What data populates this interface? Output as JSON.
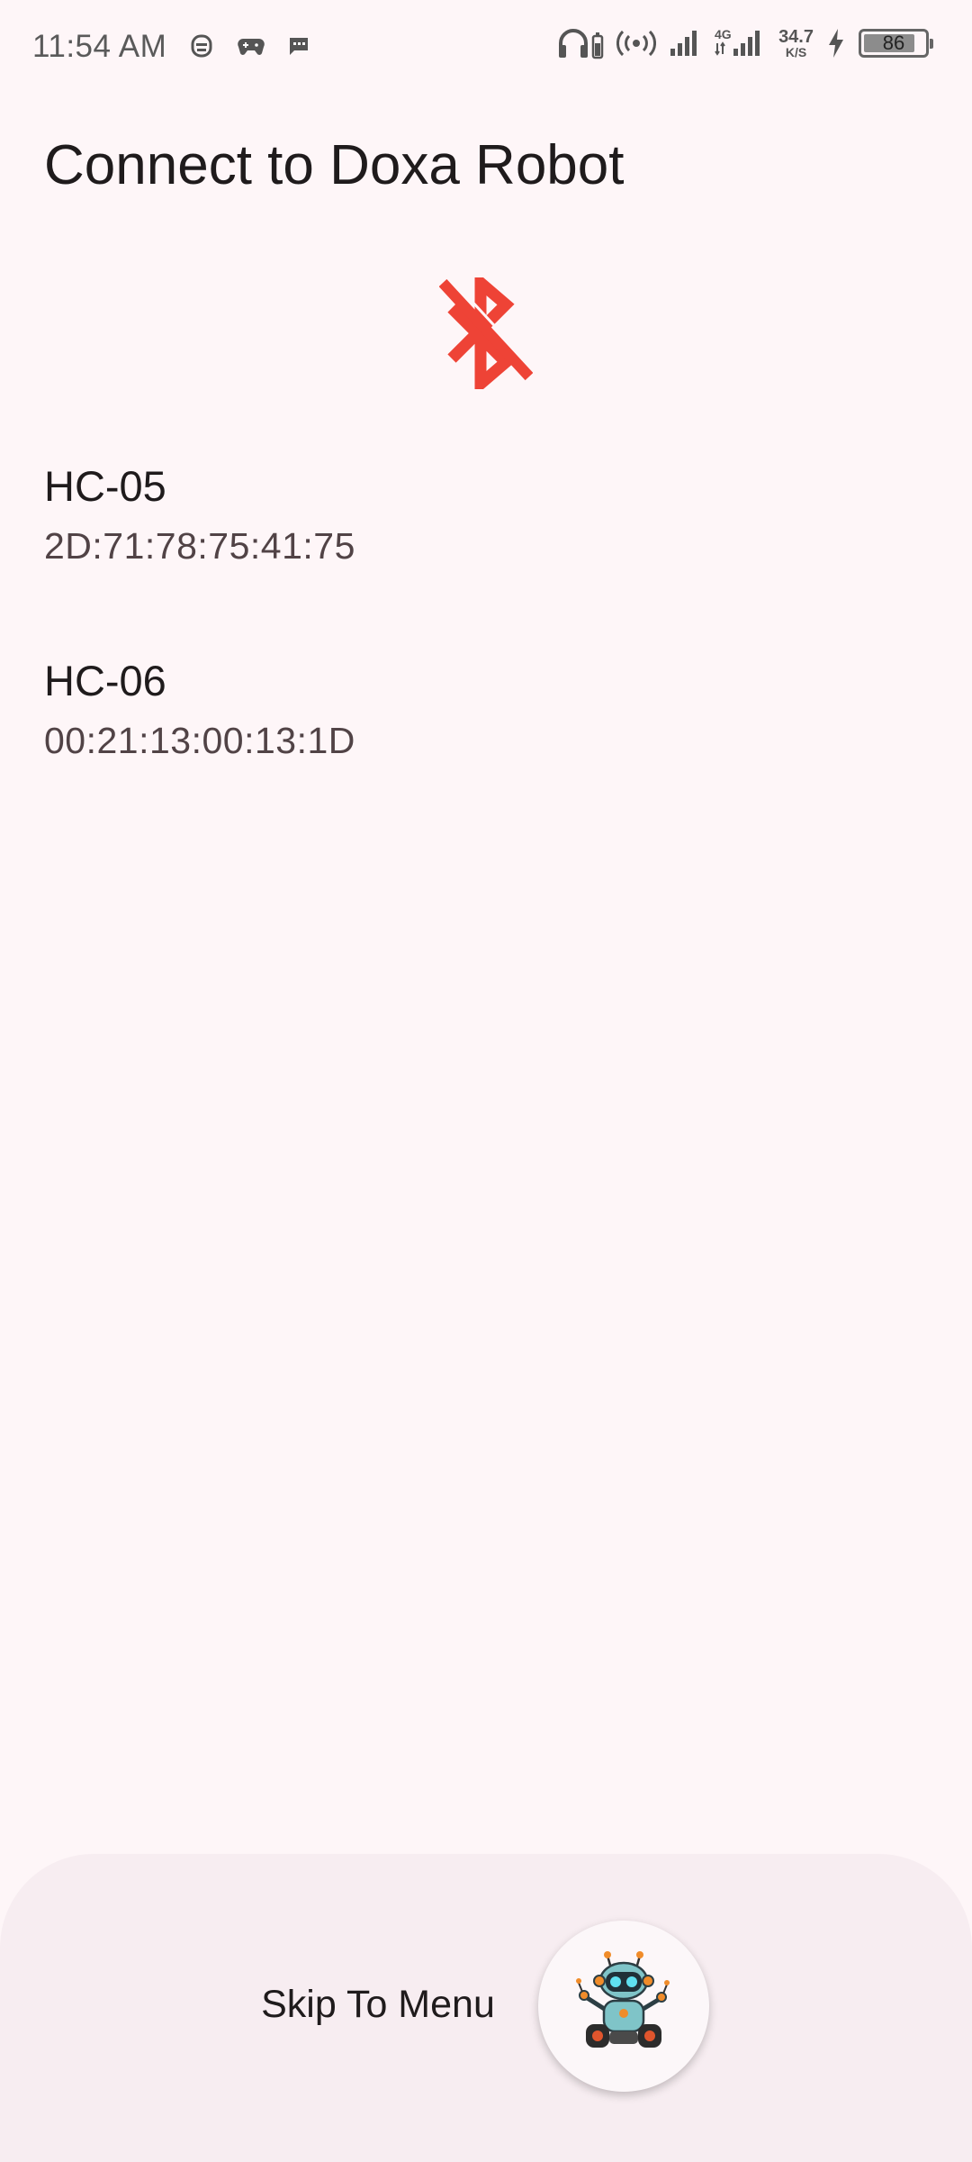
{
  "status_bar": {
    "time": "11:54 AM",
    "network_speed_value": "34.7",
    "network_speed_unit": "K/S",
    "network_type": "4G",
    "battery_level": "86",
    "icons": [
      "notification-app-icon",
      "gamepad-icon",
      "message-icon",
      "headphones-icon",
      "hotspot-icon",
      "signal-icon",
      "signal-4g-icon",
      "charging-icon",
      "battery-icon"
    ]
  },
  "page": {
    "title": "Connect to Doxa Robot",
    "bluetooth_status_icon": "bluetooth-disabled-icon",
    "accent_color": "#EE4336"
  },
  "devices": [
    {
      "name": "HC-05",
      "address": "2D:71:78:75:41:75"
    },
    {
      "name": "HC-06",
      "address": "00:21:13:00:13:1D"
    }
  ],
  "bottom_bar": {
    "skip_label": "Skip To Menu",
    "fab_icon": "robot-mascot-icon"
  }
}
